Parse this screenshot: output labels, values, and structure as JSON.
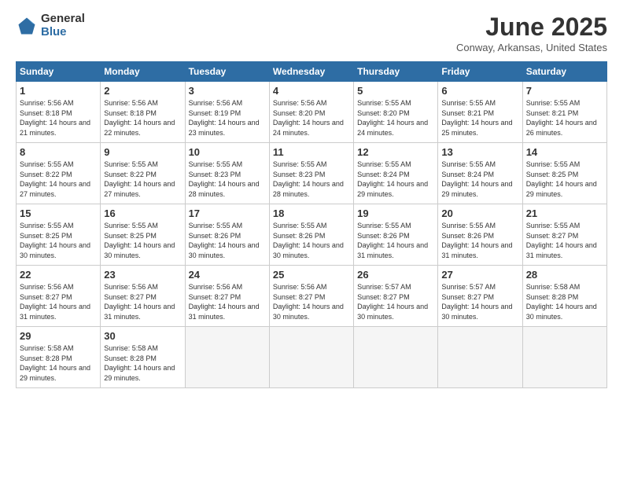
{
  "logo": {
    "general": "General",
    "blue": "Blue"
  },
  "header": {
    "title": "June 2025",
    "subtitle": "Conway, Arkansas, United States"
  },
  "days_of_week": [
    "Sunday",
    "Monday",
    "Tuesday",
    "Wednesday",
    "Thursday",
    "Friday",
    "Saturday"
  ],
  "weeks": [
    [
      {
        "day": "1",
        "sunrise": "5:56 AM",
        "sunset": "8:18 PM",
        "daylight": "14 hours and 21 minutes."
      },
      {
        "day": "2",
        "sunrise": "5:56 AM",
        "sunset": "8:18 PM",
        "daylight": "14 hours and 22 minutes."
      },
      {
        "day": "3",
        "sunrise": "5:56 AM",
        "sunset": "8:19 PM",
        "daylight": "14 hours and 23 minutes."
      },
      {
        "day": "4",
        "sunrise": "5:56 AM",
        "sunset": "8:20 PM",
        "daylight": "14 hours and 24 minutes."
      },
      {
        "day": "5",
        "sunrise": "5:55 AM",
        "sunset": "8:20 PM",
        "daylight": "14 hours and 24 minutes."
      },
      {
        "day": "6",
        "sunrise": "5:55 AM",
        "sunset": "8:21 PM",
        "daylight": "14 hours and 25 minutes."
      },
      {
        "day": "7",
        "sunrise": "5:55 AM",
        "sunset": "8:21 PM",
        "daylight": "14 hours and 26 minutes."
      }
    ],
    [
      {
        "day": "8",
        "sunrise": "5:55 AM",
        "sunset": "8:22 PM",
        "daylight": "14 hours and 27 minutes."
      },
      {
        "day": "9",
        "sunrise": "5:55 AM",
        "sunset": "8:22 PM",
        "daylight": "14 hours and 27 minutes."
      },
      {
        "day": "10",
        "sunrise": "5:55 AM",
        "sunset": "8:23 PM",
        "daylight": "14 hours and 28 minutes."
      },
      {
        "day": "11",
        "sunrise": "5:55 AM",
        "sunset": "8:23 PM",
        "daylight": "14 hours and 28 minutes."
      },
      {
        "day": "12",
        "sunrise": "5:55 AM",
        "sunset": "8:24 PM",
        "daylight": "14 hours and 29 minutes."
      },
      {
        "day": "13",
        "sunrise": "5:55 AM",
        "sunset": "8:24 PM",
        "daylight": "14 hours and 29 minutes."
      },
      {
        "day": "14",
        "sunrise": "5:55 AM",
        "sunset": "8:25 PM",
        "daylight": "14 hours and 29 minutes."
      }
    ],
    [
      {
        "day": "15",
        "sunrise": "5:55 AM",
        "sunset": "8:25 PM",
        "daylight": "14 hours and 30 minutes."
      },
      {
        "day": "16",
        "sunrise": "5:55 AM",
        "sunset": "8:25 PM",
        "daylight": "14 hours and 30 minutes."
      },
      {
        "day": "17",
        "sunrise": "5:55 AM",
        "sunset": "8:26 PM",
        "daylight": "14 hours and 30 minutes."
      },
      {
        "day": "18",
        "sunrise": "5:55 AM",
        "sunset": "8:26 PM",
        "daylight": "14 hours and 30 minutes."
      },
      {
        "day": "19",
        "sunrise": "5:55 AM",
        "sunset": "8:26 PM",
        "daylight": "14 hours and 31 minutes."
      },
      {
        "day": "20",
        "sunrise": "5:55 AM",
        "sunset": "8:26 PM",
        "daylight": "14 hours and 31 minutes."
      },
      {
        "day": "21",
        "sunrise": "5:55 AM",
        "sunset": "8:27 PM",
        "daylight": "14 hours and 31 minutes."
      }
    ],
    [
      {
        "day": "22",
        "sunrise": "5:56 AM",
        "sunset": "8:27 PM",
        "daylight": "14 hours and 31 minutes."
      },
      {
        "day": "23",
        "sunrise": "5:56 AM",
        "sunset": "8:27 PM",
        "daylight": "14 hours and 31 minutes."
      },
      {
        "day": "24",
        "sunrise": "5:56 AM",
        "sunset": "8:27 PM",
        "daylight": "14 hours and 31 minutes."
      },
      {
        "day": "25",
        "sunrise": "5:56 AM",
        "sunset": "8:27 PM",
        "daylight": "14 hours and 30 minutes."
      },
      {
        "day": "26",
        "sunrise": "5:57 AM",
        "sunset": "8:27 PM",
        "daylight": "14 hours and 30 minutes."
      },
      {
        "day": "27",
        "sunrise": "5:57 AM",
        "sunset": "8:27 PM",
        "daylight": "14 hours and 30 minutes."
      },
      {
        "day": "28",
        "sunrise": "5:58 AM",
        "sunset": "8:28 PM",
        "daylight": "14 hours and 30 minutes."
      }
    ],
    [
      {
        "day": "29",
        "sunrise": "5:58 AM",
        "sunset": "8:28 PM",
        "daylight": "14 hours and 29 minutes."
      },
      {
        "day": "30",
        "sunrise": "5:58 AM",
        "sunset": "8:28 PM",
        "daylight": "14 hours and 29 minutes."
      },
      null,
      null,
      null,
      null,
      null
    ]
  ]
}
